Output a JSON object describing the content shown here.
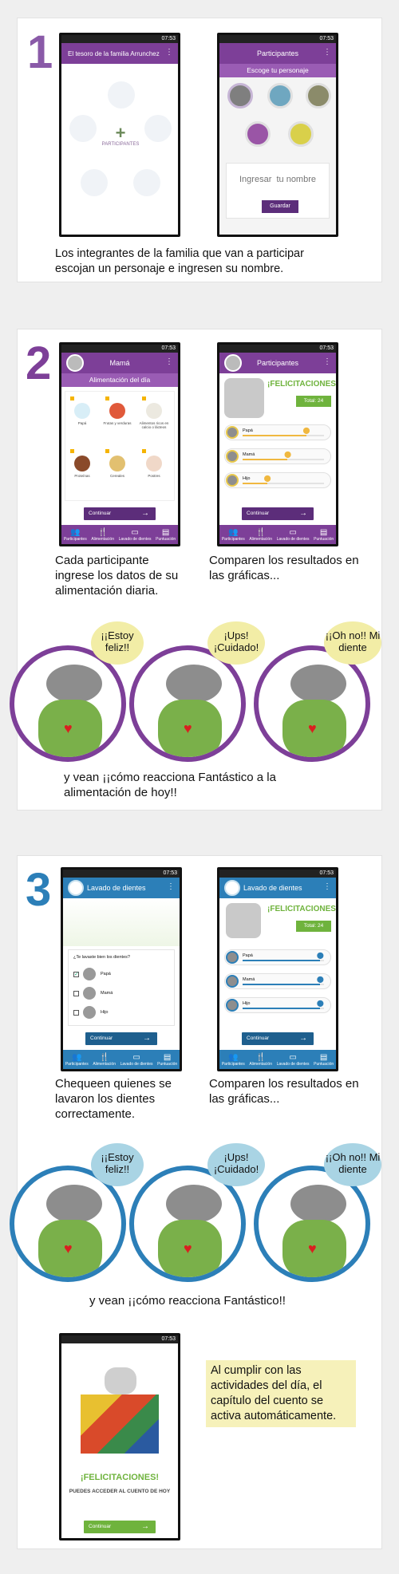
{
  "section1": {
    "number": "1",
    "phone1": {
      "status_time": "07:53",
      "title": "El tesoro de la familia Arrunchez",
      "participants_label": "PARTICIPANTES",
      "plus": "+"
    },
    "phone2": {
      "status_time": "07:53",
      "title": "Participantes",
      "subtitle": "Escoge tu personaje",
      "input_placeholder": "Ingresar  tu nombre",
      "save_label": "Guardar"
    },
    "description": "Los integrantes de la familia que van a participar escojan un personaje e ingresen su nombre."
  },
  "section2": {
    "number": "2",
    "phone1": {
      "status_time": "07:53",
      "title": "Mamá",
      "subtitle": "Alimentación del día",
      "foods": [
        "Papá",
        "Frutas y verduras",
        "Alimentos ricos en calcio o lácteos",
        "Proteínas",
        "Cereales",
        "Postres"
      ],
      "continue_label": "Continuar"
    },
    "phone2": {
      "status_time": "07:53",
      "title": "Participantes",
      "congrats": "¡FELICITACIONES!",
      "total": "Total: 24",
      "people": [
        {
          "name": "Papá",
          "value": 0.78
        },
        {
          "name": "Mamá",
          "value": 0.55
        },
        {
          "name": "Hijo",
          "value": 0.3
        }
      ],
      "continue_label": "Continuar"
    },
    "nav": [
      "Participantes",
      "Alimentación",
      "Lavado de dientes",
      "Puntuación"
    ],
    "desc_left": "Cada participante ingrese los datos de su alimentación diaria.",
    "desc_right": "Comparen los resultados en las gráficas...",
    "bubbles": [
      "¡¡Estoy feliz!!",
      "¡Ups! ¡Cuidado!",
      "¡¡Oh no!! Mi diente"
    ],
    "reaction": "y vean ¡¡cómo reacciona Fantástico a la alimentación de hoy!!"
  },
  "section3": {
    "number": "3",
    "phone1": {
      "status_time": "07:53",
      "title": "Lavado de dientes",
      "question": "¿Te lavaste bien los dientes?",
      "people": [
        "Papá",
        "Mamá",
        "Hijo"
      ],
      "continue_label": "Continuar"
    },
    "phone2": {
      "status_time": "07:53",
      "title": "Lavado de dientes",
      "congrats": "¡FELICITACIONES!",
      "total": "Total: 24",
      "people": [
        {
          "name": "Papá",
          "value": 0.95
        },
        {
          "name": "Mamá",
          "value": 0.95
        },
        {
          "name": "Hijo",
          "value": 0.95
        }
      ],
      "continue_label": "Continuar"
    },
    "nav": [
      "Participantes",
      "Alimentación",
      "Lavado de dientes",
      "Puntuación"
    ],
    "desc_left": "Chequeen quienes se lavaron los dientes correctamente.",
    "desc_right": "Comparen los resultados en las gráficas...",
    "bubbles": [
      "¡¡Estoy feliz!!",
      "¡Ups! ¡Cuidado!",
      "¡¡Oh no!! Mi diente"
    ],
    "reaction": "y vean ¡¡cómo reacciona Fantástico!!",
    "phone3": {
      "status_time": "07:53",
      "congrats": "¡FELICITACIONES!",
      "message": "PUEDES ACCEDER AL CUENTO DE HOY",
      "continue_label": "Continuar"
    },
    "story_note": "Al cumplir con las actividades del día, el capítulo del cuento se activa automáticamente."
  },
  "colors": {
    "purple": "#7d3f98",
    "blue": "#2c7fb8",
    "yellow_note": "#f6f1ba",
    "green": "#6fb33d"
  }
}
